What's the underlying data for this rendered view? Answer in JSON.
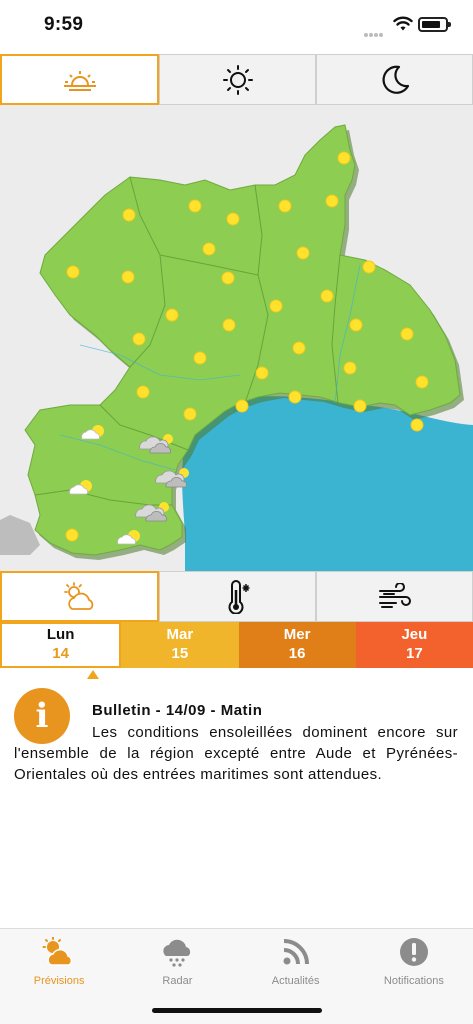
{
  "status_bar": {
    "time": "9:59"
  },
  "period_tabs": [
    {
      "name": "morning",
      "icon": "sunrise-icon",
      "active": true
    },
    {
      "name": "afternoon",
      "icon": "sun-icon",
      "active": false
    },
    {
      "name": "night",
      "icon": "moon-icon",
      "active": false
    }
  ],
  "map": {
    "land_color": "#8ccd52",
    "sea_color": "#3bb4d1",
    "background_color": "#ececec",
    "sun_color": "#ffe22e",
    "weather_icons": [
      "sun-icon",
      "partly-cloudy-icon",
      "cloudy-sun-icon"
    ]
  },
  "mode_tabs": [
    {
      "name": "weather",
      "icon": "partly-cloudy-icon",
      "active": true
    },
    {
      "name": "temperature",
      "icon": "thermometer-icon",
      "active": false
    },
    {
      "name": "wind",
      "icon": "wind-icon",
      "active": false
    }
  ],
  "days": [
    {
      "name": "Lun",
      "num": "14",
      "active": true,
      "color": "#ffffff"
    },
    {
      "name": "Mar",
      "num": "15",
      "active": false,
      "color": "#f0b52a"
    },
    {
      "name": "Mer",
      "num": "16",
      "active": false,
      "color": "#e07f17"
    },
    {
      "name": "Jeu",
      "num": "17",
      "active": false,
      "color": "#f3622d"
    }
  ],
  "bulletin": {
    "icon_letter": "i",
    "title": "Bulletin - 14/09 - Matin",
    "text": "Les conditions ensoleillées dominent encore sur l'ensemble de la région excepté entre Aude et Pyrénées-Orientales où des entrées maritimes sont attendues."
  },
  "bottom_nav": [
    {
      "label": "Prévisions",
      "icon": "partly-cloudy-icon",
      "active": true
    },
    {
      "label": "Radar",
      "icon": "rain-cloud-icon",
      "active": false
    },
    {
      "label": "Actualités",
      "icon": "rss-icon",
      "active": false
    },
    {
      "label": "Notifications",
      "icon": "alert-icon",
      "active": false
    }
  ],
  "colors": {
    "accent": "#f0a51d",
    "inactive": "#8c8c8c"
  }
}
